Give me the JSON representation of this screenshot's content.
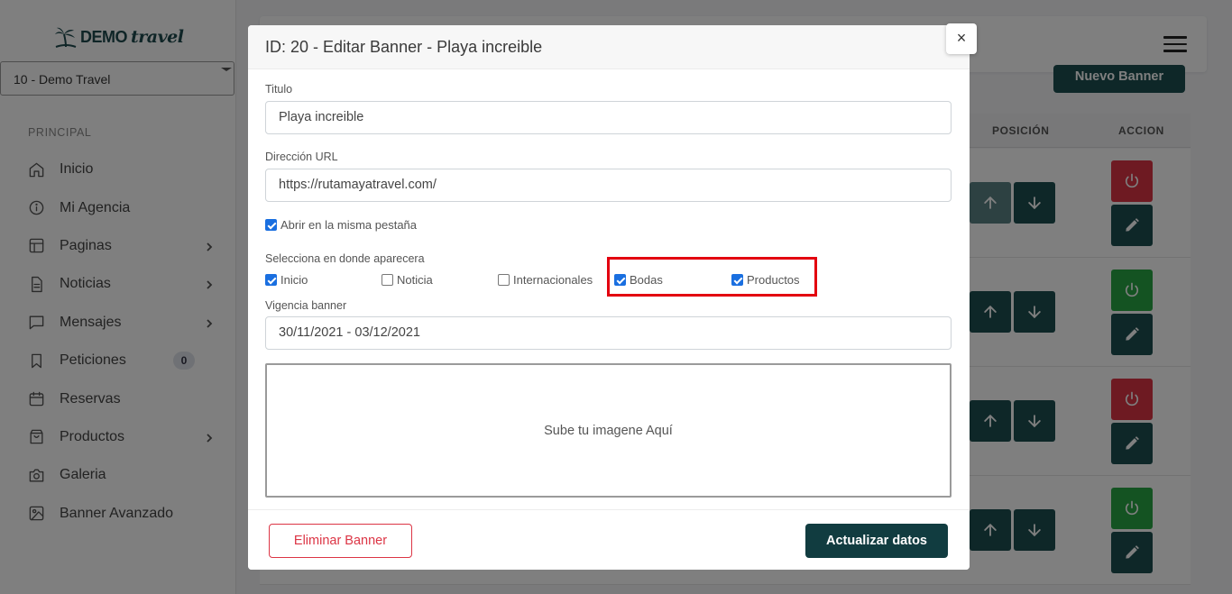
{
  "sidebar": {
    "logo_text": "DEMO",
    "logo_script": "travel",
    "agency_select": "10 - Demo Travel",
    "section_title": "PRINCIPAL",
    "items": [
      {
        "label": "Inicio",
        "icon": "home-icon"
      },
      {
        "label": "Mi Agencia",
        "icon": "info-icon"
      },
      {
        "label": "Paginas",
        "icon": "layout-icon"
      },
      {
        "label": "Noticias",
        "icon": "file-text-icon"
      },
      {
        "label": "Mensajes",
        "icon": "message-icon"
      },
      {
        "label": "Peticiones",
        "icon": "bookmark-icon",
        "badge": "0"
      },
      {
        "label": "Reservas",
        "icon": "calendar-icon"
      },
      {
        "label": "Productos",
        "icon": "shopping-bag-icon"
      },
      {
        "label": "Galeria",
        "icon": "camera-icon"
      },
      {
        "label": "Banner Avanzado",
        "icon": "image-icon"
      }
    ]
  },
  "main": {
    "new_banner_label": "Nuevo Banner",
    "columns": {
      "position": "POSICIÓN",
      "action": "ACCION"
    },
    "row_status": [
      "inactive",
      "active",
      "inactive",
      "active"
    ]
  },
  "modal": {
    "title": "ID: 20 - Editar Banner - Playa increible",
    "close_label": "×",
    "titulo_label": "Titulo",
    "titulo_value": "Playa increible",
    "url_label": "Dirección URL",
    "url_value": "https://rutamayatravel.com/",
    "same_tab_label": "Abrir en la misma pestaña",
    "same_tab_checked": true,
    "locations_label": "Selecciona en donde aparecera",
    "locations": [
      {
        "label": "Inicio",
        "checked": true
      },
      {
        "label": "Noticia",
        "checked": false
      },
      {
        "label": "Internacionales",
        "checked": false
      },
      {
        "label": "Bodas",
        "checked": true
      },
      {
        "label": "Productos",
        "checked": true
      }
    ],
    "vigencia_label": "Vigencia banner",
    "vigencia_value": "30/11/2021 - 03/12/2021",
    "upload_text": "Sube tu imagene Aquí",
    "delete_label": "Eliminar Banner",
    "update_label": "Actualizar datos"
  },
  "colors": {
    "primary": "#1d4e51",
    "danger": "#dc3545",
    "success": "#28a745",
    "highlight": "#e3000f",
    "checkbox": "#1a6fe0"
  }
}
